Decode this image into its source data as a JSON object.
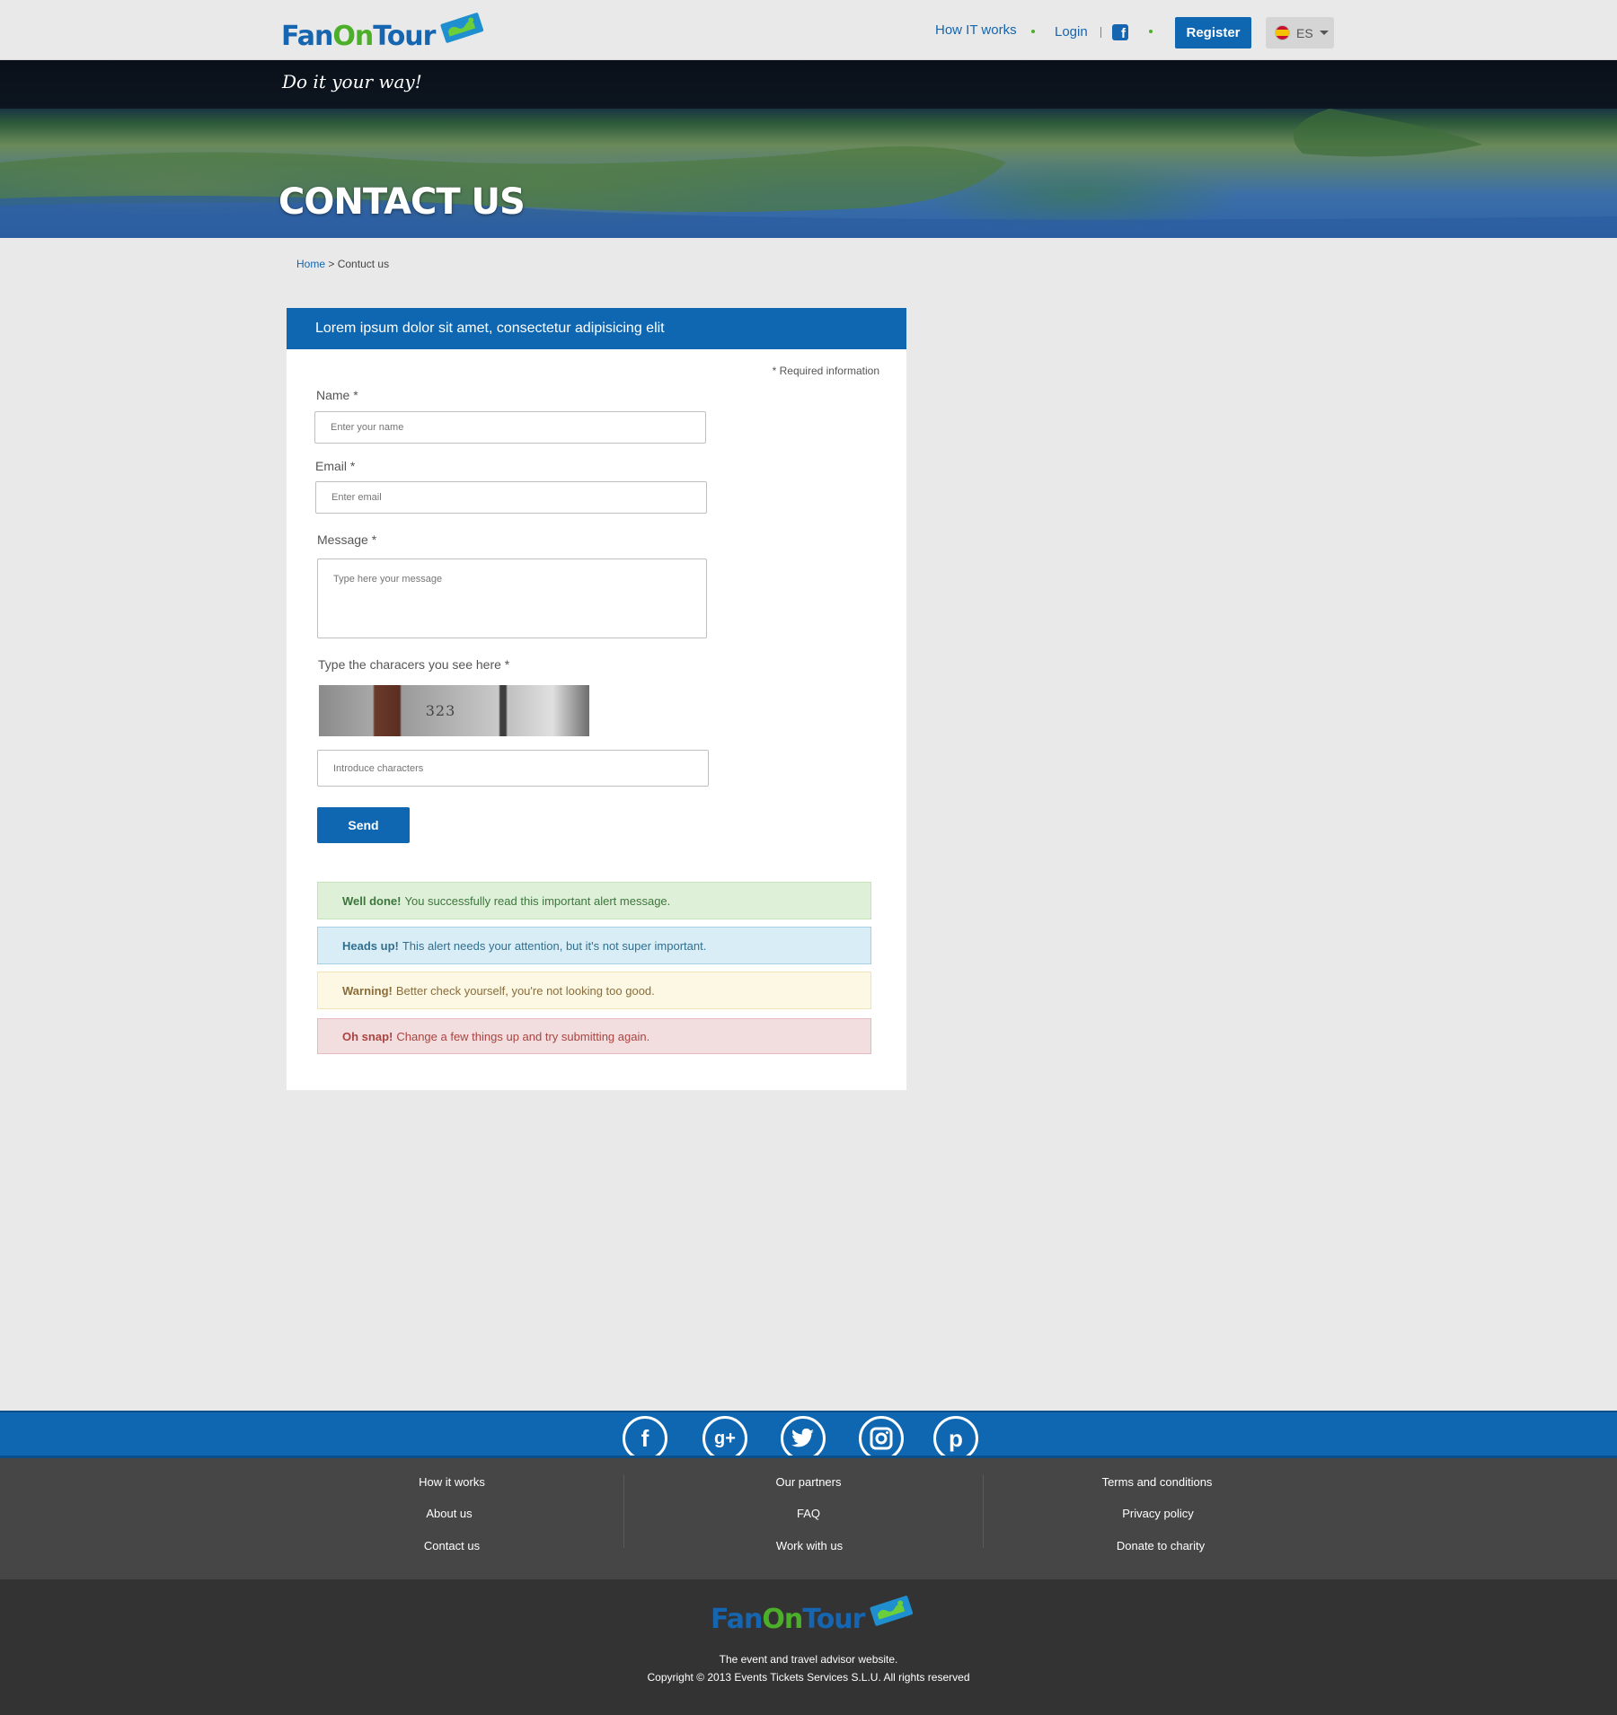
{
  "header": {
    "logo": {
      "part1": "Fan",
      "part2": "On",
      "part3": "Tour"
    },
    "nav": {
      "how_it_works": "How IT works",
      "login": "Login",
      "register": "Register"
    },
    "lang": {
      "code": "ES"
    }
  },
  "hero": {
    "tagline": "Do it your way!",
    "title": "CONTACT US"
  },
  "breadcrumb": {
    "home": "Home",
    "separator": ">",
    "current": "Contuct us"
  },
  "form": {
    "heading": "Lorem ipsum dolor sit amet, consectetur adipisicing elit",
    "required_note": "* Required information",
    "name": {
      "label": "Name *",
      "placeholder": "Enter your name"
    },
    "email": {
      "label": "Email *",
      "placeholder": "Enter email"
    },
    "message": {
      "label": "Message *",
      "placeholder": "Type here your message"
    },
    "captcha": {
      "label": "Type the characers you see here *",
      "image_text": "323",
      "placeholder": "Introduce characters"
    },
    "send": "Send"
  },
  "alerts": [
    {
      "title": "Well done!",
      "text": "You successfully read this important alert message."
    },
    {
      "title": "Heads up!",
      "text": "This alert needs your attention, but it's not super important."
    },
    {
      "title": "Warning!",
      "text": "Better check yourself, you're not looking too good."
    },
    {
      "title": "Oh snap!",
      "text": "Change a few things up and try submitting again."
    }
  ],
  "footer": {
    "social": [
      "facebook-icon",
      "google-plus-icon",
      "twitter-icon",
      "instagram-icon",
      "pinterest-icon"
    ],
    "col1": [
      "How it works",
      "About us",
      "Contact us"
    ],
    "col2": [
      "Our partners",
      "FAQ",
      "Work with us"
    ],
    "col3": [
      "Terms and conditions",
      "Privacy policy",
      "Donate to charity"
    ],
    "tagline": "The event and travel advisor website.",
    "copyright": "Copyright © 2013 Events Tickets Services S.L.U. All rights reserved"
  },
  "colors": {
    "brand_blue": "#0f67b1",
    "brand_green": "#4caf2a",
    "footer_dark": "#333333"
  }
}
